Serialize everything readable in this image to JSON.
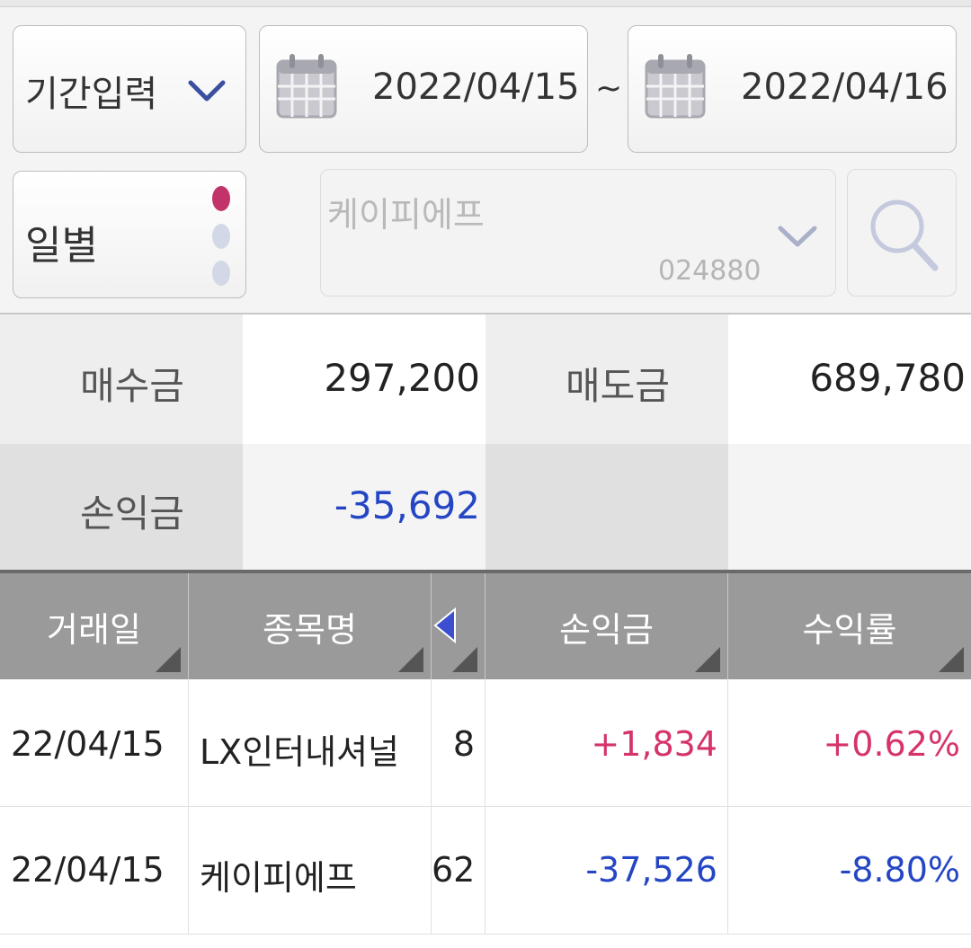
{
  "filter": {
    "period_label": "기간입력",
    "start_date": "2022/04/15",
    "separator": "~",
    "end_date": "2022/04/16",
    "mode_label": "일별",
    "stock_name": "케이피에프",
    "stock_code": "024880"
  },
  "summary": {
    "buy_label": "매수금",
    "buy_value": "297,200",
    "sell_label": "매도금",
    "sell_value": "689,780",
    "pnl_label": "손익금",
    "pnl_value": "-35,692"
  },
  "table": {
    "headers": [
      "거래일",
      "종목명",
      "",
      "손익금",
      "수익률"
    ],
    "rows": [
      {
        "date": "22/04/15",
        "name": "LX인터내셔널",
        "qty": "8",
        "pnl": "+1,834",
        "rate": "+0.62%",
        "sign": "positive"
      },
      {
        "date": "22/04/15",
        "name": "케이피에프",
        "qty": "62",
        "pnl": "-37,526",
        "rate": "-8.80%",
        "sign": "negative"
      }
    ]
  },
  "colors": {
    "positive": "#d6336c",
    "negative": "#2446c4",
    "header_bg": "#9a9a9a",
    "chevron": "#3a4fa0"
  },
  "icons": [
    "chevron-down-icon",
    "calendar-icon",
    "search-icon",
    "sort-triangle-icon",
    "left-arrow-icon"
  ]
}
